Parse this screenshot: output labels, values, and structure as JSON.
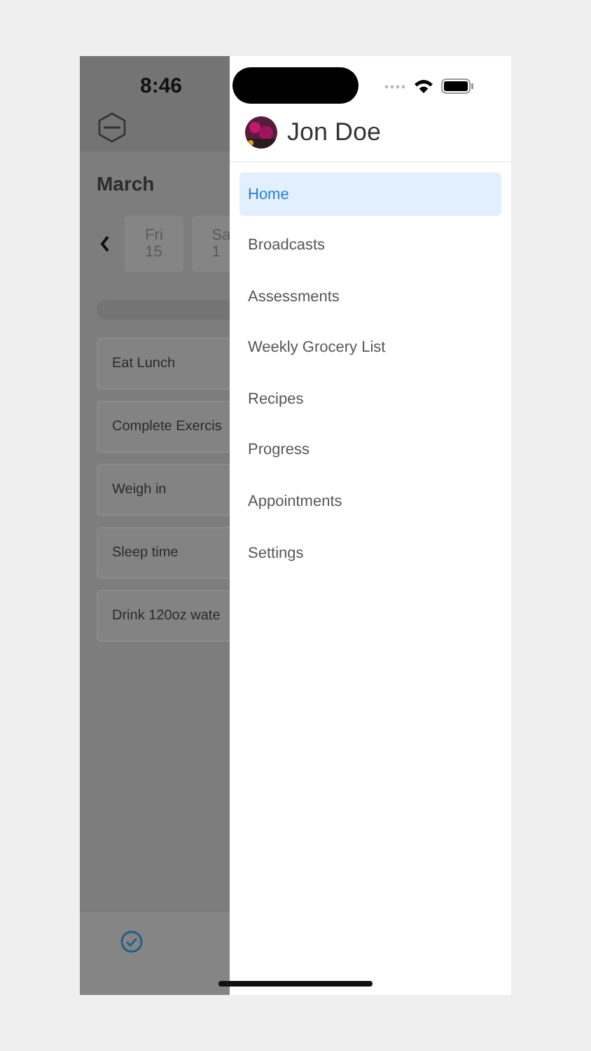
{
  "status_bar": {
    "time": "8:46"
  },
  "background_screen": {
    "month": "March",
    "dates": [
      {
        "day": "Fri",
        "date": "15"
      },
      {
        "day": "Sa",
        "date": "1"
      }
    ],
    "tasks": [
      {
        "label": "Eat Lunch"
      },
      {
        "label": "Complete Exercis"
      },
      {
        "label": "Weigh in"
      },
      {
        "label": "Sleep time"
      },
      {
        "label": "Drink 120oz wate"
      }
    ]
  },
  "drawer": {
    "user_name": "Jon Doe",
    "menu": [
      {
        "label": "Home",
        "selected": true
      },
      {
        "label": "Broadcasts",
        "selected": false
      },
      {
        "label": "Assessments",
        "selected": false
      },
      {
        "label": "Weekly Grocery List",
        "selected": false
      },
      {
        "label": "Recipes",
        "selected": false
      },
      {
        "label": "Progress",
        "selected": false
      },
      {
        "label": "Appointments",
        "selected": false
      },
      {
        "label": "Settings",
        "selected": false
      }
    ]
  }
}
